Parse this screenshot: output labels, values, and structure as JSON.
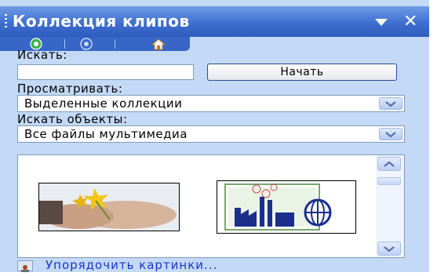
{
  "pane": {
    "title": "Коллекция клипов"
  },
  "tabs": [
    {
      "icon": "green-circle-icon"
    },
    {
      "icon": "globe-circle-icon"
    },
    {
      "icon": "home-icon"
    }
  ],
  "search": {
    "label": "Искать:",
    "value": "",
    "button_label": "Начать"
  },
  "browse": {
    "label": "Просматривать:",
    "selected": "Выделенные коллекции"
  },
  "find_objects": {
    "label": "Искать объекты:",
    "selected": "Все файлы мультимедиа"
  },
  "results": {
    "items": [
      {
        "icon": "flowers-hands-clip"
      },
      {
        "icon": "factory-globe-clip"
      }
    ]
  },
  "footer": {
    "link": "Упорядочить картинки..."
  },
  "colors": {
    "pane_bg": "#c4d9f6",
    "title_bar": "#3f6fd0",
    "link": "#1a35c9"
  }
}
